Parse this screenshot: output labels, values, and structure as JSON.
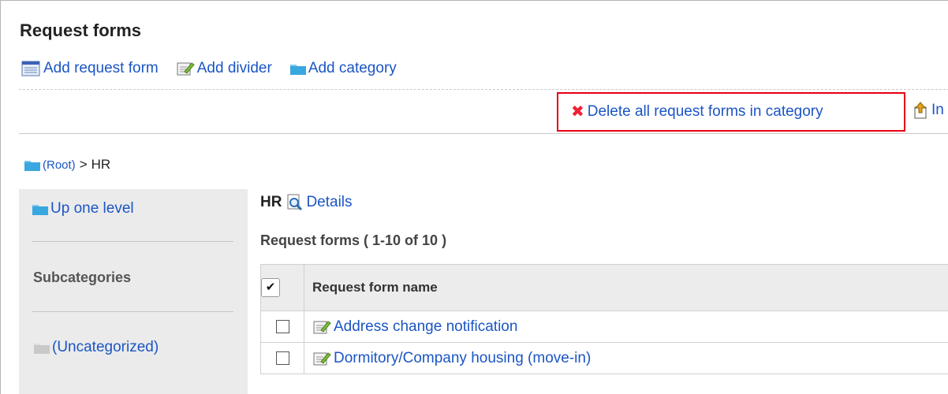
{
  "page_title": "Request forms",
  "toolbar": {
    "add_form": "Add request form",
    "add_divider": "Add divider",
    "add_category": "Add category"
  },
  "actions": {
    "delete_all": "Delete all request forms in category",
    "import_partial": "In"
  },
  "breadcrumb": {
    "root": "(Root)",
    "separator": ">",
    "current": "HR"
  },
  "sidebar": {
    "up_level": "Up one level",
    "subcategories_heading": "Subcategories",
    "uncategorized": "(Uncategorized)"
  },
  "category": {
    "name": "HR",
    "details_link": "Details"
  },
  "list": {
    "count_text": "Request forms ( 1-10 of 10 )",
    "select_all_glyph": "✔",
    "column_header": "Request form name",
    "rows": [
      {
        "name": "Address change notification"
      },
      {
        "name": "Dormitory/Company housing (move-in)"
      }
    ]
  },
  "colors": {
    "link": "#1b55c4",
    "highlight_border": "#e60012",
    "delete_icon": "#e22233",
    "sidebar_bg": "#ebebeb",
    "header_bg": "#ececec"
  }
}
